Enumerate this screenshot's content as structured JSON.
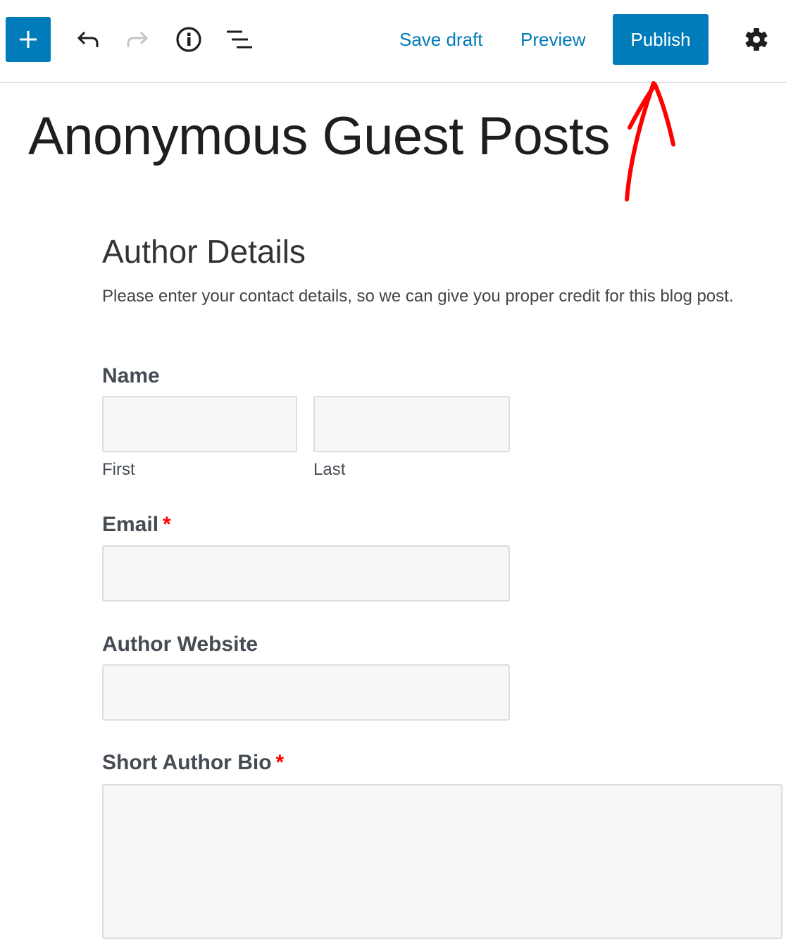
{
  "toolbar": {
    "add_block_icon": "plus-icon",
    "undo_icon": "undo-icon",
    "redo_icon": "redo-icon",
    "info_icon": "info-icon",
    "outline_icon": "block-navigation-icon",
    "save_draft_label": "Save draft",
    "preview_label": "Preview",
    "publish_label": "Publish",
    "settings_icon": "gear-icon",
    "accent_color": "#007cba"
  },
  "post": {
    "title": "Anonymous Guest Posts"
  },
  "annotation": {
    "type": "hand-drawn-arrow",
    "points_to": "Publish",
    "color": "#ff0000"
  },
  "form": {
    "heading": "Author Details",
    "description": "Please enter your contact details, so we can give you proper credit for this blog post.",
    "fields": [
      {
        "label": "Name",
        "required": false,
        "sublabels": [
          "First",
          "Last"
        ],
        "values": [
          "",
          ""
        ]
      },
      {
        "label": "Email",
        "required": true,
        "value": ""
      },
      {
        "label": "Author Website",
        "required": false,
        "value": ""
      },
      {
        "label": "Short Author Bio",
        "required": true,
        "value": ""
      }
    ],
    "required_marker": "*"
  }
}
